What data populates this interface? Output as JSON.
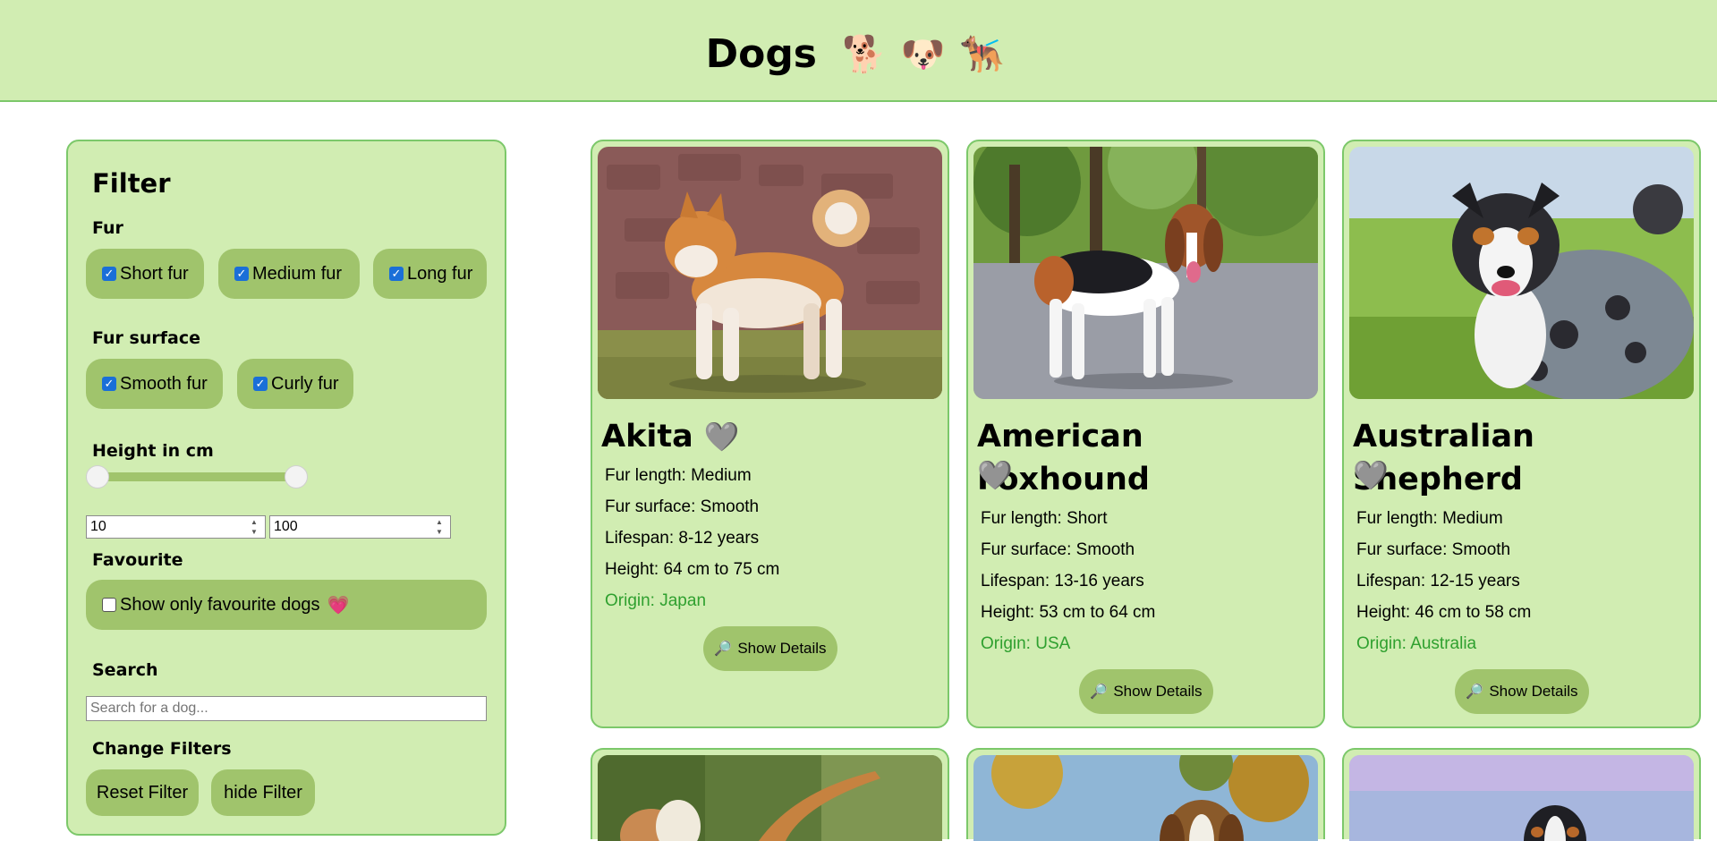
{
  "header": {
    "title": "Dogs",
    "emojis": [
      "🐕",
      "🐶",
      "🐕‍🦺"
    ]
  },
  "filter": {
    "title": "Filter",
    "fur_label": "Fur",
    "fur_options": [
      {
        "label": "Short fur",
        "checked": true
      },
      {
        "label": "Medium fur",
        "checked": true
      },
      {
        "label": "Long fur",
        "checked": true
      }
    ],
    "surface_label": "Fur surface",
    "surface_options": [
      {
        "label": "Smooth fur",
        "checked": true
      },
      {
        "label": "Curly fur",
        "checked": true
      }
    ],
    "height_label": "Height in cm",
    "height_min": "10",
    "height_max": "100",
    "favourite_label": "Favourite",
    "favourite_option": "Show only favourite dogs",
    "favourite_heart": "💗",
    "favourite_checked": false,
    "search_label": "Search",
    "search_placeholder": "Search for a dog...",
    "change_label": "Change Filters",
    "reset_button": "Reset Filter",
    "hide_button": "hide Filter"
  },
  "cards": [
    {
      "name": "Akita",
      "heart": "🩶",
      "fur_length": "Fur length: Medium",
      "fur_surface": "Fur surface: Smooth",
      "lifespan": "Lifespan: 8-12 years",
      "height": "Height: 64 cm to 75 cm",
      "origin": "Origin: Japan",
      "details_button": "Show Details",
      "details_icon": "🔎"
    },
    {
      "name": "American Foxhound",
      "heart": "🩶",
      "fur_length": "Fur length: Short",
      "fur_surface": "Fur surface: Smooth",
      "lifespan": "Lifespan: 13-16 years",
      "height": "Height: 53 cm to 64 cm",
      "origin": "Origin: USA",
      "details_button": "Show Details",
      "details_icon": "🔎"
    },
    {
      "name": "Australian Shepherd",
      "heart": "🩶",
      "fur_length": "Fur length: Medium",
      "fur_surface": "Fur surface: Smooth",
      "lifespan": "Lifespan: 12-15 years",
      "height": "Height: 46 cm to 58 cm",
      "origin": "Origin: Australia",
      "details_button": "Show Details",
      "details_icon": "🔎"
    }
  ],
  "colors": {
    "panel_bg": "#d1edb2",
    "border": "#7cc86a",
    "chip_bg": "#a0c46c",
    "origin_text": "#2fa02f",
    "checkbox_blue": "#1a6fd8"
  }
}
